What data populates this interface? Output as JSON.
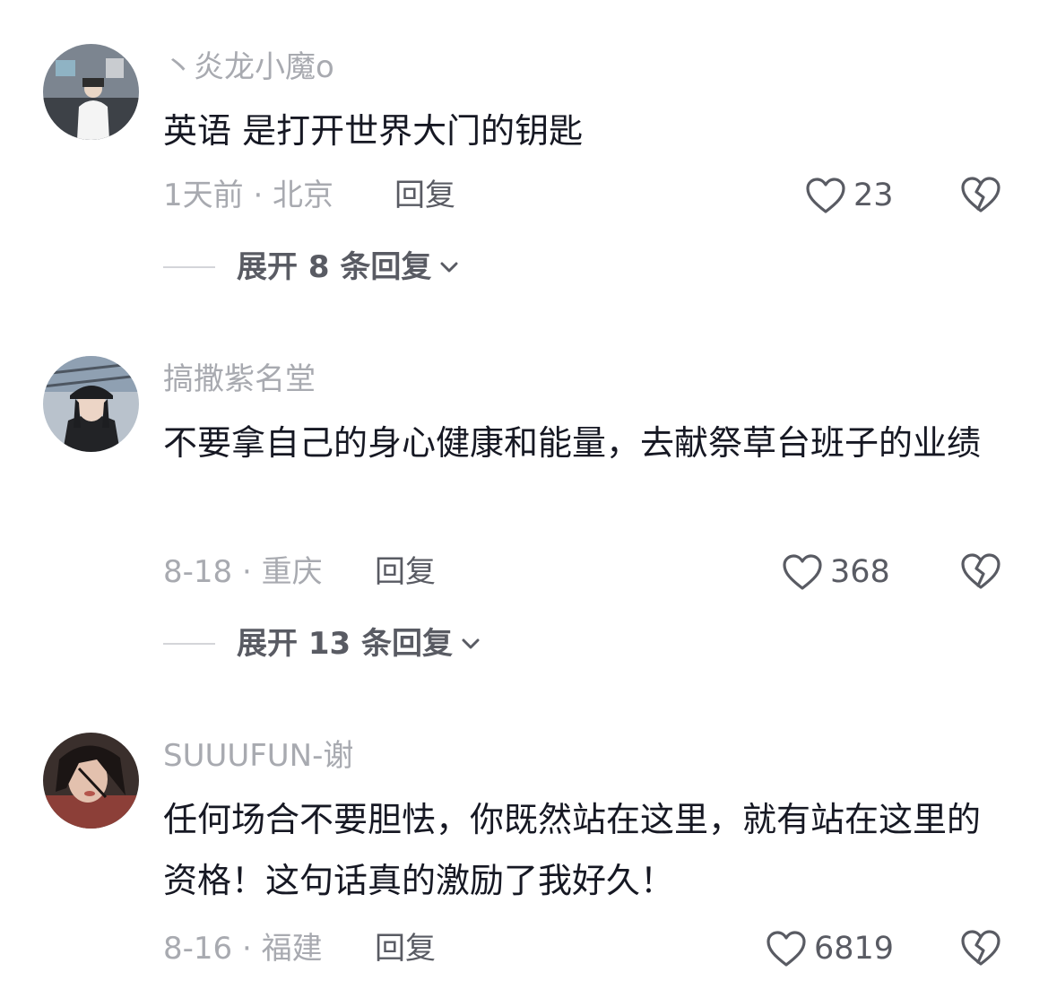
{
  "comments": [
    {
      "username": "丶炎龙小魔o",
      "text": "英语 是打开世界大门的钥匙",
      "meta": "1天前 · 北京",
      "reply_label": "回复",
      "likes": "23",
      "expand_label": "展开 8 条回复",
      "avatar_icon": "avatar-person-white-hoodie"
    },
    {
      "username": "搞撒紫名堂",
      "text": "不要拿自己的身心健康和能量，去献祭草台班子的业绩",
      "meta": "8-18 · 重庆",
      "reply_label": "回复",
      "likes": "368",
      "expand_label": "展开 13 条回复",
      "avatar_icon": "avatar-person-black-cap"
    },
    {
      "username": "SUUUFUN-谢",
      "text": "任何场合不要胆怯，你既然站在这里，就有站在这里的资格！这句话真的激励了我好久！",
      "meta": "8-16 · 福建",
      "reply_label": "回复",
      "likes": "6819",
      "avatar_icon": "avatar-person-red-tone"
    }
  ],
  "icons": {
    "like": "heart-outline-icon",
    "dislike": "broken-heart-icon",
    "expand": "chevron-down-icon"
  },
  "colors": {
    "primary_text": "#161823",
    "secondary_text": "#a8aab0",
    "action_text": "#595b63"
  }
}
